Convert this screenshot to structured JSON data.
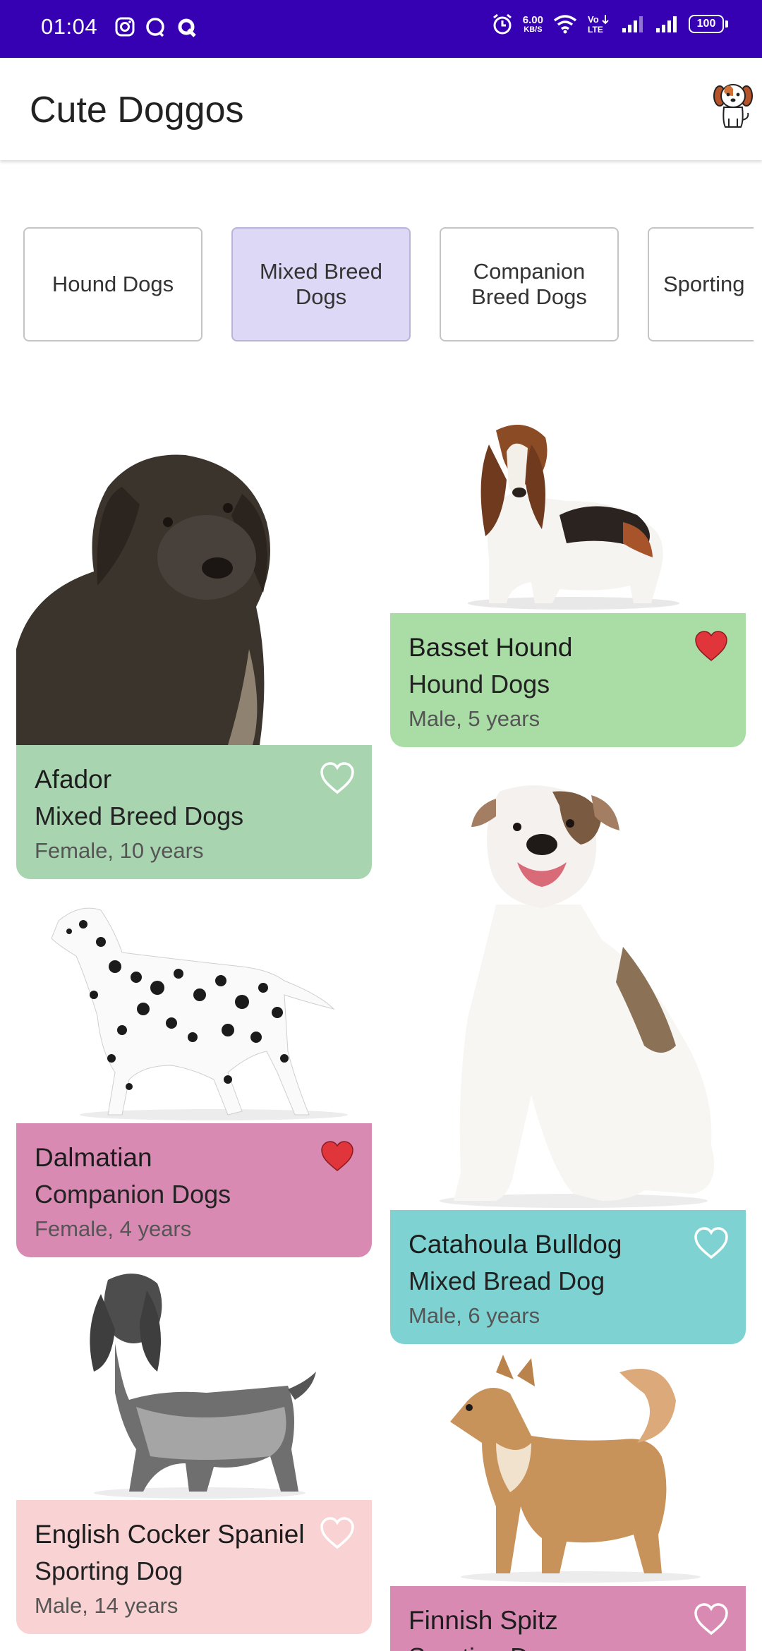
{
  "status_bar": {
    "time": "01:04",
    "net_speed_value": "6.00",
    "net_speed_unit": "KB/S",
    "volte": "VoLTE",
    "battery": "100"
  },
  "app_bar": {
    "title": "Cute Doggos",
    "avatar_icon": "dog-avatar-icon"
  },
  "categories": [
    {
      "label": "Hound Dogs",
      "selected": false
    },
    {
      "label": "Mixed Breed Dogs",
      "selected": true
    },
    {
      "label": "Companion Breed Dogs",
      "selected": false
    },
    {
      "label": "Sporting",
      "selected": false
    }
  ],
  "dogs": [
    {
      "name": "Afador",
      "group": "Mixed Breed Dogs",
      "details": "Female, 10 years",
      "favorite": false,
      "card_color": "#a8d5b0"
    },
    {
      "name": "Basset Hound",
      "group": "Hound Dogs",
      "details": "Male, 5 years",
      "favorite": true,
      "card_color": "#aadca5"
    },
    {
      "name": "Dalmatian",
      "group": "Companion Dogs",
      "details": "Female, 4 years",
      "favorite": true,
      "card_color": "#d98ab3"
    },
    {
      "name": "Catahoula Bulldog",
      "group": "Mixed Bread Dog",
      "details": "Male, 6 years",
      "favorite": false,
      "card_color": "#7ed3d2"
    },
    {
      "name": "English Cocker Spaniel",
      "group": "Sporting Dog",
      "details": "Male, 14 years",
      "favorite": false,
      "card_color": "#f9d2d3"
    },
    {
      "name": "Finnish Spitz",
      "group": "Sporting Dog",
      "details": "",
      "favorite": false,
      "card_color": "#d98ab3"
    }
  ],
  "colors": {
    "status_bar": "#3600b3",
    "chip_selected": "#ddd8f5",
    "heart_filled": "#e0353a"
  }
}
